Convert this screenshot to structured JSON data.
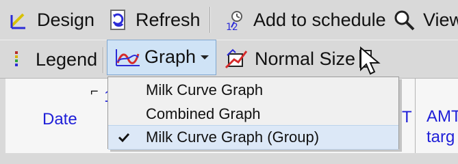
{
  "toolbar_top": {
    "design_label": "Design",
    "refresh_label": "Refresh",
    "add_schedule_label": "Add to schedule",
    "view_label": "View"
  },
  "toolbar_bottom": {
    "legend_label": "Legend",
    "graph_label": "Graph",
    "normal_size_label": "Normal Size"
  },
  "grid": {
    "date_header": "Date",
    "partial_header_1": "1",
    "partial_header_2": "T",
    "amt_header": "AMT",
    "target_header": "targ"
  },
  "menu": {
    "items": [
      {
        "label": "Milk Curve Graph"
      },
      {
        "label": "Combined Graph"
      },
      {
        "label": "Milk Curve Graph (Group)"
      }
    ]
  },
  "icons": {
    "design": "design-icon",
    "refresh": "refresh-icon",
    "schedule": "schedule-icon",
    "view": "view-icon",
    "legend": "legend-icon",
    "graph": "graph-icon",
    "normal_size": "normal-size-icon",
    "select": "select-icon",
    "check": "check-icon",
    "cursor": "cursor-icon"
  },
  "colors": {
    "toolbar_bg": "#d9d9d9",
    "menu_bg": "#f0f0f0",
    "header_text": "#1f1fd8",
    "selected_button": "#cfe3f6"
  }
}
